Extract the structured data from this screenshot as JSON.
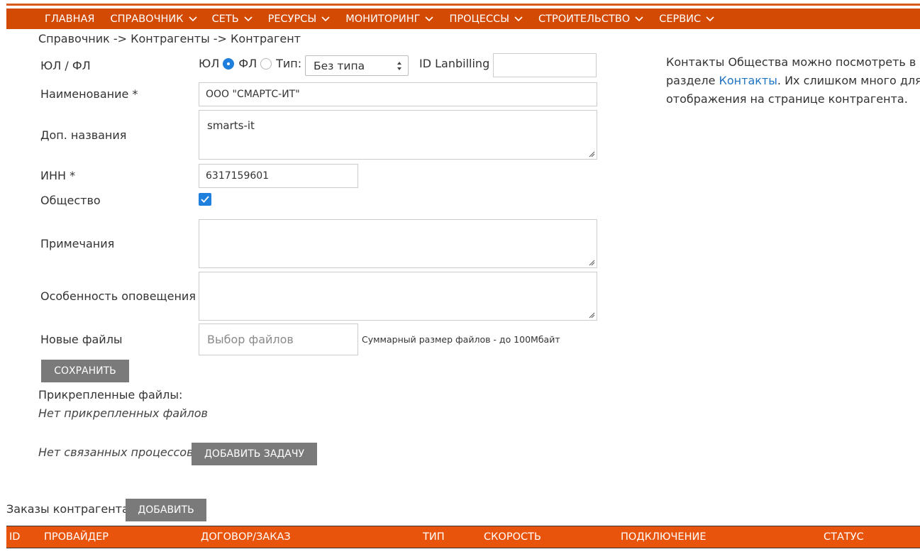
{
  "nav": {
    "items": [
      {
        "label": "ГЛАВНАЯ",
        "dropdown": false
      },
      {
        "label": "СПРАВОЧНИК",
        "dropdown": true
      },
      {
        "label": "СЕТЬ",
        "dropdown": true
      },
      {
        "label": "РЕСУРСЫ",
        "dropdown": true
      },
      {
        "label": "МОНИТОРИНГ",
        "dropdown": true
      },
      {
        "label": "ПРОЦЕССЫ",
        "dropdown": true
      },
      {
        "label": "СТРОИТЕЛЬСТВО",
        "dropdown": true
      },
      {
        "label": "СЕРВИС",
        "dropdown": true
      }
    ]
  },
  "breadcrumb": "Справочник -> Контрагенты -> Контрагент",
  "form": {
    "entity_type_label": "ЮЛ / ФЛ",
    "radio_ul_label": "ЮЛ",
    "radio_fl_label": "ФЛ",
    "type_label": "Тип:",
    "type_value": "Без типа",
    "lanbilling_label": "ID Lanbilling",
    "lanbilling_value": "",
    "name_label": "Наименование *",
    "name_value": "ООО \"СМАРТС-ИТ\"",
    "alt_names_label": "Доп. названия",
    "alt_names_value": "smarts-it",
    "inn_label": "ИНН *",
    "inn_value": "6317159601",
    "society_label": "Общество",
    "society_checked": true,
    "notes_label": "Примечания",
    "notes_value": "",
    "notify_label": "Особенность оповещения",
    "notify_value": "",
    "files_label": "Новые файлы",
    "files_button": "Выбор файлов",
    "files_hint": "Суммарный размер файлов - до 100Мбайт",
    "save_button": "СОХРАНИТЬ"
  },
  "attached": {
    "title": "Прикрепленные файлы:",
    "empty": "Нет прикрепленных файлов"
  },
  "processes": {
    "empty": "Нет связанных процессов",
    "add_task_button": "ДОБАВИТЬ ЗАДАЧУ"
  },
  "side_note": {
    "line1": "Контакты Общества можно посмотреть в",
    "line2_before": "разделе ",
    "link": "Контакты",
    "line2_after": ". Их слишком много для",
    "line3": "отображения на странице контрагента."
  },
  "orders": {
    "label": "Заказы контрагента:",
    "add_button": "ДОБАВИТЬ",
    "columns": [
      "ID",
      "ПРОВАЙДЕР",
      "ДОГОВОР/ЗАКАЗ",
      "ТИП",
      "СКОРОСТЬ",
      "ПОДКЛЮЧЕНИЕ",
      "СТАТУС"
    ]
  },
  "colors": {
    "nav_bg": "#d24a04",
    "table_header_bg": "#e8540c",
    "button_bg": "#7a7a7a",
    "accent": "#1e7fdc",
    "link": "#1f74c3"
  }
}
